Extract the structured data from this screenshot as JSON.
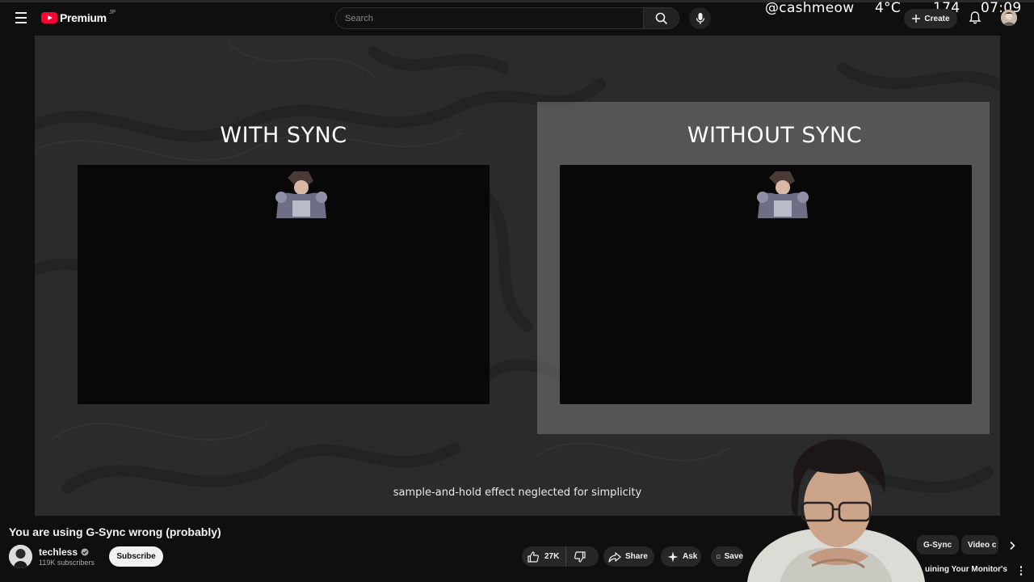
{
  "header": {
    "logo_word": "Premium",
    "logo_region": "JP",
    "search_placeholder": "Search",
    "create_label": "Create"
  },
  "stream_overlay": {
    "handle": "@cashmeow",
    "temperature": "4°C",
    "counter": "174",
    "clock": "07:09"
  },
  "video": {
    "left_title": "WITH SYNC",
    "right_title": "WITHOUT SYNC",
    "caption": "sample-and-hold effect neglected for simplicity"
  },
  "watch": {
    "title": "You are using G-Sync wrong (probably)",
    "channel_name": "techless",
    "subscribers": "119K subscribers",
    "subscribe_label": "Subscribe",
    "likes": "27K",
    "share_label": "Share",
    "ask_label": "Ask",
    "save_label": "Save"
  },
  "related": {
    "chips": [
      "G-Sync",
      "Video c"
    ],
    "next_title": "uining Your Monitor's"
  },
  "colors": {
    "brand_red": "#ff0033",
    "background": "#0f0f0f",
    "video_bg": "#2b2b2b"
  }
}
